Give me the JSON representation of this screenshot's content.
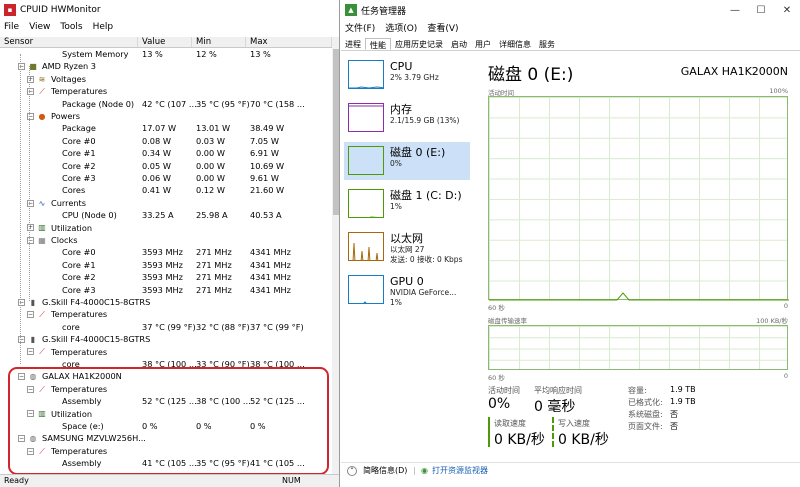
{
  "hw": {
    "title": "CPUID HWMonitor",
    "menu": [
      "File",
      "View",
      "Tools",
      "Help"
    ],
    "header": [
      "Sensor",
      "Value",
      "Min",
      "Max"
    ],
    "rows": [
      {
        "label": "System Memory",
        "v": "13 %",
        "mn": "12 %",
        "mx": "13 %",
        "lvl": 3,
        "icon": ""
      },
      {
        "label": "AMD Ryzen 3",
        "v": "",
        "mn": "",
        "mx": "",
        "lvl": 1,
        "icon": "cpu-chip-icon",
        "pm": "−"
      },
      {
        "label": "Voltages",
        "v": "",
        "mn": "",
        "mx": "",
        "lvl": 2,
        "icon": "voltage-icon",
        "pm": "+"
      },
      {
        "label": "Temperatures",
        "v": "",
        "mn": "",
        "mx": "",
        "lvl": 2,
        "icon": "thermometer-icon",
        "pm": "−"
      },
      {
        "label": "Package (Node 0)",
        "v": "42 °C  (107 ...",
        "mn": "35 °C  (95 °F)",
        "mx": "70 °C  (158 ...",
        "lvl": 3,
        "icon": ""
      },
      {
        "label": "Powers",
        "v": "",
        "mn": "",
        "mx": "",
        "lvl": 2,
        "icon": "power-icon",
        "pm": "−"
      },
      {
        "label": "Package",
        "v": "17.07 W",
        "mn": "13.01 W",
        "mx": "38.49 W",
        "lvl": 3,
        "icon": ""
      },
      {
        "label": "Core #0",
        "v": "0.08 W",
        "mn": "0.03 W",
        "mx": "7.05 W",
        "lvl": 3,
        "icon": ""
      },
      {
        "label": "Core #1",
        "v": "0.34 W",
        "mn": "0.00 W",
        "mx": "6.91 W",
        "lvl": 3,
        "icon": ""
      },
      {
        "label": "Core #2",
        "v": "0.05 W",
        "mn": "0.00 W",
        "mx": "10.69 W",
        "lvl": 3,
        "icon": ""
      },
      {
        "label": "Core #3",
        "v": "0.06 W",
        "mn": "0.00 W",
        "mx": "9.61 W",
        "lvl": 3,
        "icon": ""
      },
      {
        "label": "Cores",
        "v": "0.41 W",
        "mn": "0.12 W",
        "mx": "21.60 W",
        "lvl": 3,
        "icon": ""
      },
      {
        "label": "Currents",
        "v": "",
        "mn": "",
        "mx": "",
        "lvl": 2,
        "icon": "current-icon",
        "pm": "−"
      },
      {
        "label": "CPU (Node 0)",
        "v": "33.25 A",
        "mn": "25.98 A",
        "mx": "40.53 A",
        "lvl": 3,
        "icon": ""
      },
      {
        "label": "Utilization",
        "v": "",
        "mn": "",
        "mx": "",
        "lvl": 2,
        "icon": "utilization-icon",
        "pm": "+"
      },
      {
        "label": "Clocks",
        "v": "",
        "mn": "",
        "mx": "",
        "lvl": 2,
        "icon": "clock-icon",
        "pm": "−"
      },
      {
        "label": "Core #0",
        "v": "3593 MHz",
        "mn": "271 MHz",
        "mx": "4341 MHz",
        "lvl": 3,
        "icon": ""
      },
      {
        "label": "Core #1",
        "v": "3593 MHz",
        "mn": "271 MHz",
        "mx": "4341 MHz",
        "lvl": 3,
        "icon": ""
      },
      {
        "label": "Core #2",
        "v": "3593 MHz",
        "mn": "271 MHz",
        "mx": "4341 MHz",
        "lvl": 3,
        "icon": ""
      },
      {
        "label": "Core #3",
        "v": "3593 MHz",
        "mn": "271 MHz",
        "mx": "4341 MHz",
        "lvl": 3,
        "icon": ""
      },
      {
        "label": "G.Skill F4-4000C15-8GTRS",
        "v": "",
        "mn": "",
        "mx": "",
        "lvl": 1,
        "icon": "memory-module-icon",
        "pm": "−"
      },
      {
        "label": "Temperatures",
        "v": "",
        "mn": "",
        "mx": "",
        "lvl": 2,
        "icon": "thermometer-icon",
        "pm": "−"
      },
      {
        "label": "core",
        "v": "37 °C  (99 °F)",
        "mn": "32 °C  (88 °F)",
        "mx": "37 °C  (99 °F)",
        "lvl": 3,
        "icon": ""
      },
      {
        "label": "G.Skill F4-4000C15-8GTRS",
        "v": "",
        "mn": "",
        "mx": "",
        "lvl": 1,
        "icon": "memory-module-icon",
        "pm": "−"
      },
      {
        "label": "Temperatures",
        "v": "",
        "mn": "",
        "mx": "",
        "lvl": 2,
        "icon": "thermometer-icon",
        "pm": "−"
      },
      {
        "label": "core",
        "v": "38 °C  (100 ...",
        "mn": "33 °C  (90 °F)",
        "mx": "38 °C  (100 ...",
        "lvl": 3,
        "icon": ""
      },
      {
        "label": "GALAX HA1K2000N",
        "v": "",
        "mn": "",
        "mx": "",
        "lvl": 1,
        "icon": "drive-icon",
        "pm": "−"
      },
      {
        "label": "Temperatures",
        "v": "",
        "mn": "",
        "mx": "",
        "lvl": 2,
        "icon": "thermometer-icon",
        "pm": "−"
      },
      {
        "label": "Assembly",
        "v": "52 °C  (125 ...",
        "mn": "38 °C  (100 ...",
        "mx": "52 °C  (125 ...",
        "lvl": 3,
        "icon": ""
      },
      {
        "label": "Utilization",
        "v": "",
        "mn": "",
        "mx": "",
        "lvl": 2,
        "icon": "utilization-icon",
        "pm": "−"
      },
      {
        "label": "Space (e:)",
        "v": "0 %",
        "mn": "0 %",
        "mx": "0 %",
        "lvl": 3,
        "icon": ""
      },
      {
        "label": "SAMSUNG MZVLW256H...",
        "v": "",
        "mn": "",
        "mx": "",
        "lvl": 1,
        "icon": "drive-icon",
        "pm": "−"
      },
      {
        "label": "Temperatures",
        "v": "",
        "mn": "",
        "mx": "",
        "lvl": 2,
        "icon": "thermometer-icon",
        "pm": "−"
      },
      {
        "label": "Assembly",
        "v": "41 °C  (105 ...",
        "mn": "35 °C  (95 °F)",
        "mx": "41 °C  (105 ...",
        "lvl": 3,
        "icon": ""
      }
    ],
    "status_left": "Ready",
    "status_right": "NUM",
    "highlight_color": "#d0262c"
  },
  "tm": {
    "title": "任务管理器",
    "menu": [
      "文件(F)",
      "选项(O)",
      "查看(V)"
    ],
    "tabs": [
      "进程",
      "性能",
      "应用历史记录",
      "启动",
      "用户",
      "详细信息",
      "服务"
    ],
    "active_tab": "性能",
    "side": [
      {
        "name": "CPU",
        "sub1": "2% 3.79 GHz",
        "sub2": "",
        "color": "#1a7dc4"
      },
      {
        "name": "内存",
        "sub1": "2.1/15.9 GB (13%)",
        "sub2": "",
        "color": "#8b2fa8"
      },
      {
        "name": "磁盘 0 (E:)",
        "sub1": "0%",
        "sub2": "",
        "color": "#4d9a06"
      },
      {
        "name": "磁盘 1 (C: D:)",
        "sub1": "1%",
        "sub2": "",
        "color": "#4d9a06"
      },
      {
        "name": "以太网",
        "sub1": "以太网 27",
        "sub2": "发送: 0 接收: 0 Kbps",
        "color": "#a9680e"
      },
      {
        "name": "GPU 0",
        "sub1": "NVIDIA GeForce...",
        "sub2": "1%",
        "color": "#1a7dc4"
      }
    ],
    "selected": 2,
    "main": {
      "title": "磁盘 0 (E:)",
      "model": "GALAX HA1K2000N",
      "active_time_label": "活动时间",
      "pct_max": "100%",
      "sixty": "60 秒",
      "zero": "0",
      "transfer_label": "磁盘传输速率",
      "transfer_max": "100 KB/秒",
      "stats": {
        "active_time_k": "活动时间",
        "active_time_v": "0%",
        "avg_resp_k": "平均响应时间",
        "avg_resp_v": "0 毫秒",
        "read_k": "读取速度",
        "read_v": "0 KB/秒",
        "write_k": "写入速度",
        "write_v": "0 KB/秒",
        "capacity_k": "容量:",
        "capacity_v": "1.9 TB",
        "formatted_k": "已格式化:",
        "formatted_v": "1.9 TB",
        "sysdisk_k": "系统磁盘:",
        "sysdisk_v": "否",
        "pagefile_k": "页面文件:",
        "pagefile_v": "否"
      }
    },
    "footer": {
      "brief": "简略信息(D)",
      "open": "打开资源监视器"
    }
  }
}
